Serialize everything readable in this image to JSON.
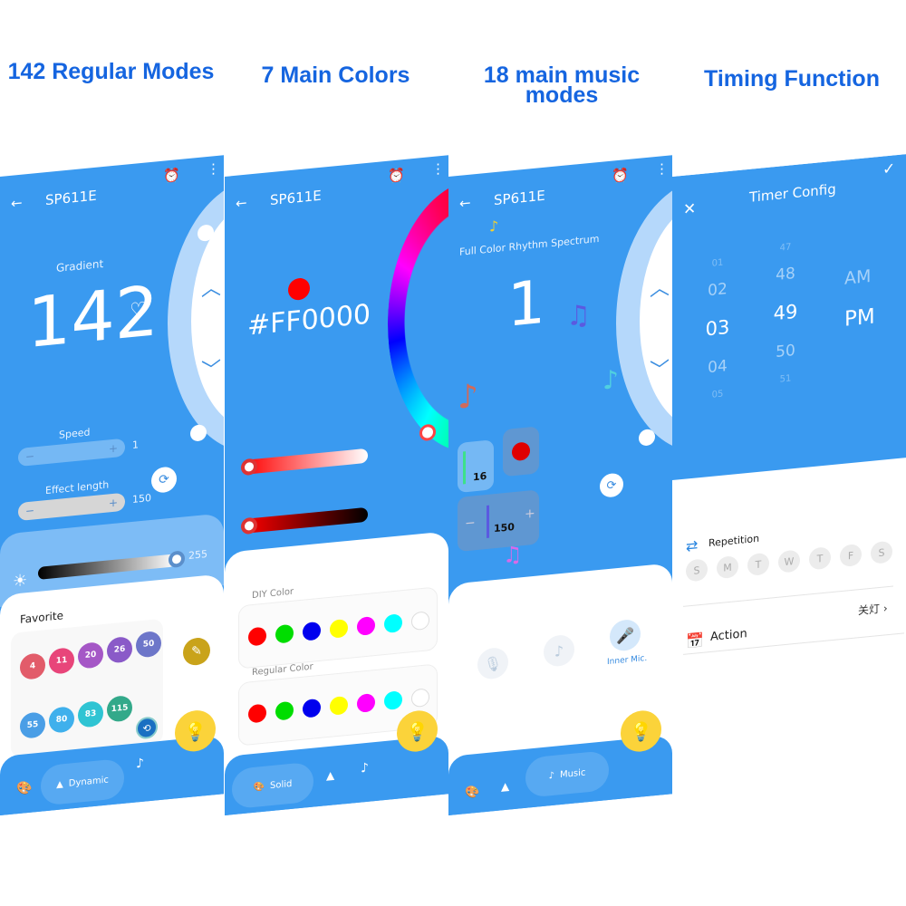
{
  "captions": [
    "142 Regular Modes",
    "7 Main Colors",
    "18 main music modes",
    "Timing Function"
  ],
  "colors": {
    "primary": "#3a9af0",
    "light": "#b5d8fb",
    "bulb": "#fbd33a",
    "pencil": "#c9a31a"
  },
  "screen1": {
    "title": "SP611E",
    "mode_name": "Gradient",
    "mode_number": "142",
    "speed_label": "Speed",
    "speed_value": "1",
    "effect_label": "Effect length",
    "effect_value": "150",
    "brightness_value": "255",
    "favorite_label": "Favorite",
    "favorites": [
      {
        "n": "4",
        "c": "#e25c6a"
      },
      {
        "n": "11",
        "c": "#e8457a"
      },
      {
        "n": "20",
        "c": "#a557c6"
      },
      {
        "n": "26",
        "c": "#8a5ac8"
      },
      {
        "n": "50",
        "c": "#6d76c9"
      },
      {
        "n": "55",
        "c": "#4a9ee6"
      },
      {
        "n": "80",
        "c": "#3fb0ec"
      },
      {
        "n": "83",
        "c": "#2fc4d3"
      },
      {
        "n": "115",
        "c": "#33a98a"
      }
    ],
    "nav": {
      "active": "Dynamic"
    }
  },
  "screen2": {
    "title": "SP611E",
    "hex": "#FF0000",
    "current_color": "#ff0000",
    "diy_label": "DIY Color",
    "regular_label": "Regular Color",
    "diy_colors": [
      "#ff0000",
      "#00dd00",
      "#0000ee",
      "#ffff00",
      "#ff00ff",
      "#00ffff",
      "#ffffff"
    ],
    "regular_colors": [
      "#ff0000",
      "#00dd00",
      "#0000ee",
      "#ffff00",
      "#ff00ff",
      "#00ffff",
      "#ffffff"
    ],
    "nav": {
      "active": "Solid"
    }
  },
  "screen3": {
    "title": "SP611E",
    "mode_name": "Full Color Rhythm Spectrum",
    "mode_number": "1",
    "sensitivity": "16",
    "length": "150",
    "record_color": "#e00000",
    "mic_label": "Inner Mic.",
    "nav": {
      "active": "Music"
    }
  },
  "screen4": {
    "title": "Timer Config",
    "hours": [
      "01",
      "02",
      "03",
      "04",
      "05"
    ],
    "minutes": [
      "47",
      "48",
      "49",
      "50",
      "51"
    ],
    "ampm": [
      "AM",
      "PM"
    ],
    "repetition_label": "Repetition",
    "days": [
      "S",
      "M",
      "T",
      "W",
      "T",
      "F",
      "S"
    ],
    "action_label": "Action",
    "action_value": "关灯"
  }
}
